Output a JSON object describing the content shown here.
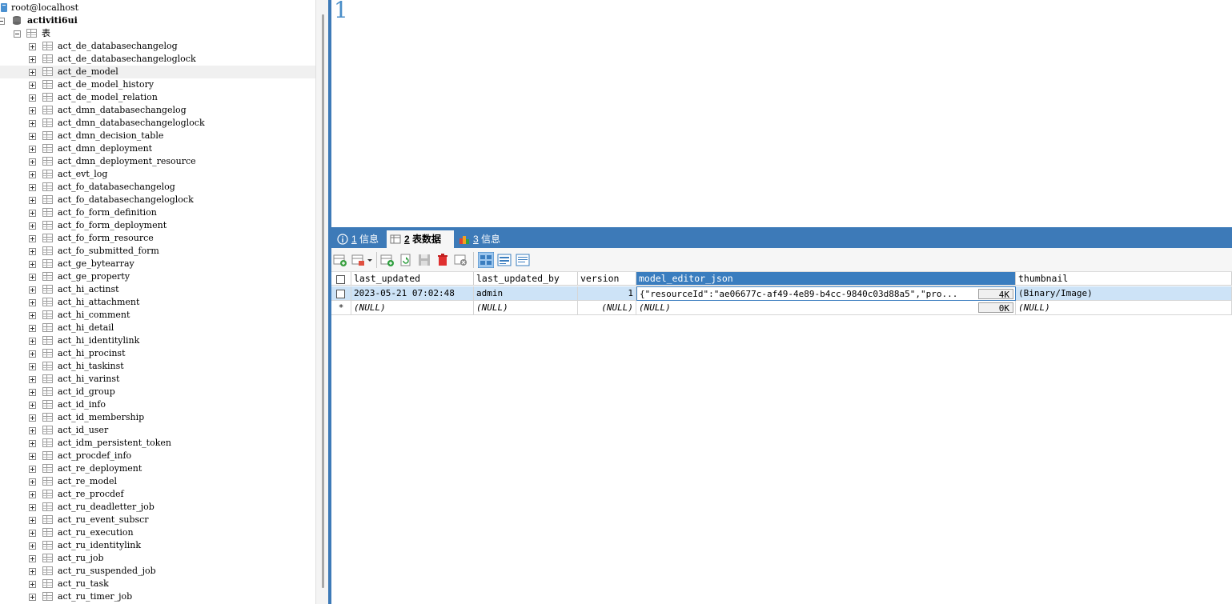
{
  "tree": {
    "server": "root@localhost",
    "database": "activiti6ui",
    "tables_folder": "表",
    "tables": [
      "act_de_databasechangelog",
      "act_de_databasechangeloglock",
      "act_de_model",
      "act_de_model_history",
      "act_de_model_relation",
      "act_dmn_databasechangelog",
      "act_dmn_databasechangeloglock",
      "act_dmn_decision_table",
      "act_dmn_deployment",
      "act_dmn_deployment_resource",
      "act_evt_log",
      "act_fo_databasechangelog",
      "act_fo_databasechangeloglock",
      "act_fo_form_definition",
      "act_fo_form_deployment",
      "act_fo_form_resource",
      "act_fo_submitted_form",
      "act_ge_bytearray",
      "act_ge_property",
      "act_hi_actinst",
      "act_hi_attachment",
      "act_hi_comment",
      "act_hi_detail",
      "act_hi_identitylink",
      "act_hi_procinst",
      "act_hi_taskinst",
      "act_hi_varinst",
      "act_id_group",
      "act_id_info",
      "act_id_membership",
      "act_id_user",
      "act_idm_persistent_token",
      "act_procdef_info",
      "act_re_deployment",
      "act_re_model",
      "act_re_procdef",
      "act_ru_deadletter_job",
      "act_ru_event_subscr",
      "act_ru_execution",
      "act_ru_identitylink",
      "act_ru_job",
      "act_ru_suspended_job",
      "act_ru_task",
      "act_ru_timer_job"
    ],
    "selected_index": 2
  },
  "editor": {
    "line_number": "1"
  },
  "tabs": [
    {
      "num": "1",
      "label": " 信息",
      "icon": "info-icon",
      "active": false
    },
    {
      "num": "2",
      "label": " 表数据",
      "icon": "table-icon",
      "active": true
    },
    {
      "num": "3",
      "label": " 信息",
      "icon": "chart-icon",
      "active": false
    }
  ],
  "grid": {
    "columns": [
      "last_updated",
      "last_updated_by",
      "version",
      "model_editor_json",
      "thumbnail"
    ],
    "selected_column": 3,
    "rows": [
      {
        "last_updated": "2023-05-21 07:02:48",
        "last_updated_by": "admin",
        "version": "1",
        "model_editor_json": "{\"resourceId\":\"ae06677c-af49-4e89-b4cc-9840c03d88a5\",\"pro...",
        "json_size": "4K",
        "thumbnail": "(Binary/Image)"
      },
      {
        "marker": "*",
        "last_updated": "(NULL)",
        "last_updated_by": "(NULL)",
        "version": "(NULL)",
        "model_editor_json": "(NULL)",
        "json_size": "0K",
        "thumbnail": "(NULL)"
      }
    ]
  },
  "colors": {
    "accent": "#3d7ab8",
    "selected_row": "#cde3f7",
    "selected_header": "#3a7dbf"
  }
}
